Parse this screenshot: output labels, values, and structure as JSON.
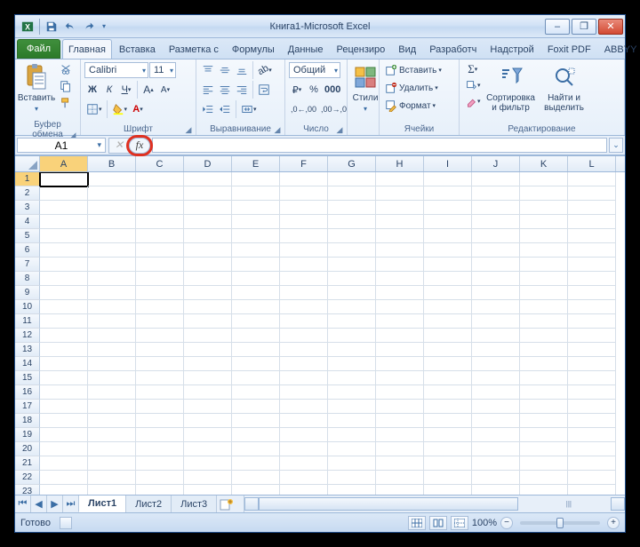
{
  "title": {
    "doc": "Книга1",
    "sep": " - ",
    "app": "Microsoft Excel"
  },
  "qat": {
    "save": "save-icon",
    "undo": "undo-icon",
    "redo": "redo-icon"
  },
  "win": {
    "min": "–",
    "max": "❐",
    "close": "✕"
  },
  "tabs": {
    "file": "Файл",
    "list": [
      "Главная",
      "Вставка",
      "Разметка с",
      "Формулы",
      "Данные",
      "Рецензиро",
      "Вид",
      "Разработч",
      "Надстрой",
      "Foxit PDF",
      "ABBYY PDF"
    ],
    "activeIndex": 0,
    "help": "?"
  },
  "ribbon": {
    "clipboard": {
      "paste": "Вставить",
      "label": "Буфер обмена"
    },
    "font": {
      "name": "Calibri",
      "size": "11",
      "label": "Шрифт"
    },
    "align": {
      "label": "Выравнивание"
    },
    "number": {
      "format": "Общий",
      "label": "Число"
    },
    "styles": {
      "label": "Стили",
      "styles_btn": "Стили"
    },
    "cells": {
      "insert": "Вставить",
      "delete": "Удалить",
      "format": "Формат",
      "label": "Ячейки"
    },
    "editing": {
      "sort": "Сортировка и фильтр",
      "find": "Найти и выделить",
      "label": "Редактирование"
    }
  },
  "formulaBar": {
    "nameBox": "A1",
    "cancel": "✕",
    "enter": "✓",
    "fx": "fx",
    "value": ""
  },
  "grid": {
    "columns": [
      "A",
      "B",
      "C",
      "D",
      "E",
      "F",
      "G",
      "H",
      "I",
      "J",
      "K",
      "L"
    ],
    "rowCount": 24,
    "activeCell": "A1"
  },
  "sheets": {
    "list": [
      "Лист1",
      "Лист2",
      "Лист3"
    ],
    "activeIndex": 0
  },
  "status": {
    "ready": "Готово",
    "zoom": "100%",
    "zoomMinus": "−",
    "zoomPlus": "+"
  },
  "scroll": {
    "tick": "|||"
  }
}
